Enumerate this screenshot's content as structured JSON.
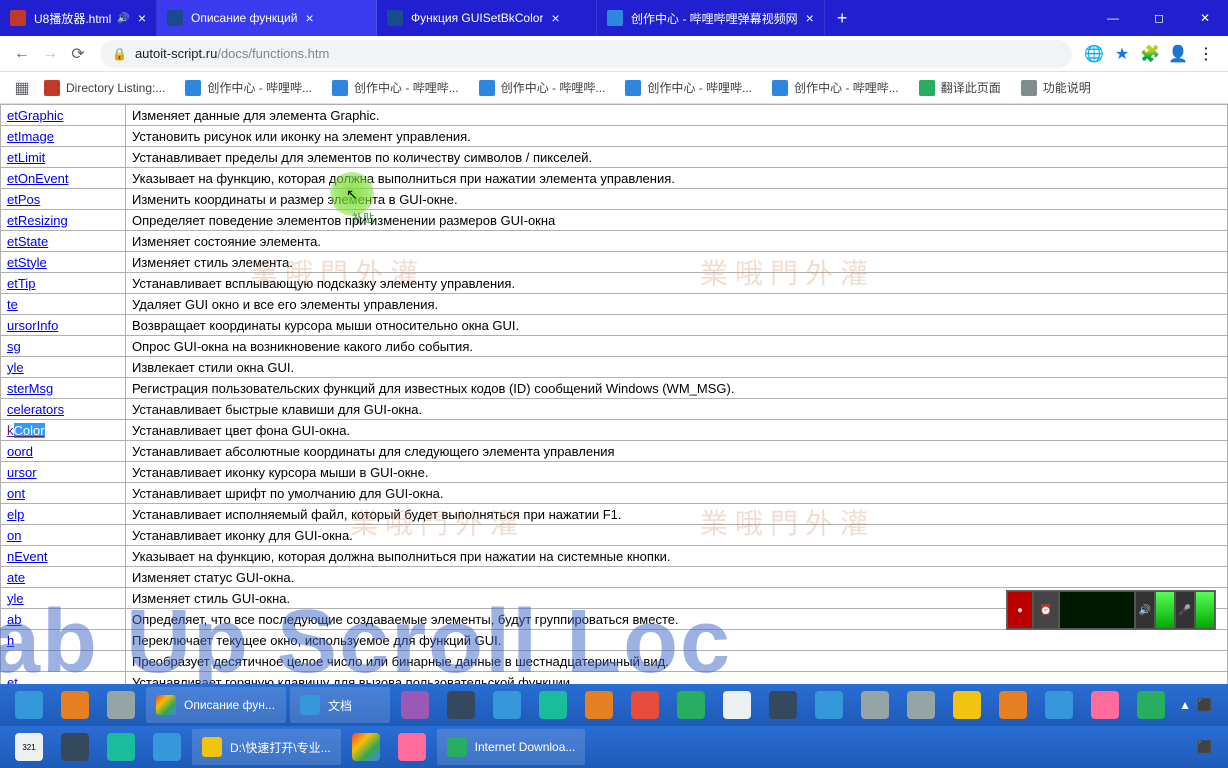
{
  "tabs": [
    {
      "title": "U8播放器.html",
      "audio": true
    },
    {
      "title": "Описание функций",
      "active": true
    },
    {
      "title": "Функция GUISetBkColor"
    },
    {
      "title": "创作中心 - 哔哩哔哩弹幕视频网"
    }
  ],
  "url": {
    "host": "autoit-script.ru",
    "path": "/docs/functions.htm"
  },
  "bookmarks": [
    {
      "label": "Directory Listing:...",
      "cls": "red"
    },
    {
      "label": "创作中心 - 哔哩哔...",
      "cls": "blue"
    },
    {
      "label": "创作中心 - 哔哩哔...",
      "cls": "blue"
    },
    {
      "label": "创作中心 - 哔哩哔...",
      "cls": "blue"
    },
    {
      "label": "创作中心 - 哔哩哔...",
      "cls": "blue"
    },
    {
      "label": "创作中心 - 哔哩哔...",
      "cls": "blue"
    },
    {
      "label": "翻译此页面",
      "cls": "green"
    },
    {
      "label": "功能说明",
      "cls": "gray"
    }
  ],
  "rows": [
    {
      "fn": "etGraphic",
      "desc": "Изменяет данные для элемента Graphic."
    },
    {
      "fn": "etImage",
      "desc": "Установить рисунок или иконку на элемент управления."
    },
    {
      "fn": "etLimit",
      "desc": "Устанавливает пределы для элементов по количеству символов / пикселей."
    },
    {
      "fn": "etOnEvent",
      "desc": "Указывает на функцию, которая должна выполниться при нажатии элемента управления."
    },
    {
      "fn": "etPos",
      "desc": "Изменить координаты и размер элемента в GUI-окне."
    },
    {
      "fn": "etResizing",
      "desc": "Определяет поведение элементов при изменении размеров GUI-окна"
    },
    {
      "fn": "etState",
      "desc": "Изменяет состояние элемента."
    },
    {
      "fn": "etStyle",
      "desc": "Изменяет стиль элемента."
    },
    {
      "fn": "etTip",
      "desc": "Устанавливает всплывающую подсказку элементу управления."
    },
    {
      "fn": "te",
      "desc": "Удаляет GUI окно и все его элементы управления."
    },
    {
      "fn": "ursorInfo",
      "desc": "Возвращает координаты курсора мыши относительно окна GUI."
    },
    {
      "fn": "sg",
      "desc": "Опрос GUI-окна на возникновение какого либо события."
    },
    {
      "fn": "yle",
      "desc": "Извлекает стили окна GUI."
    },
    {
      "fn": "sterMsg",
      "desc": "Регистрация пользовательских функций для известных кодов (ID) сообщений Windows (WM_MSG)."
    },
    {
      "fn": "celerators",
      "desc": "Устанавливает быстрые клавиши для GUI-окна."
    },
    {
      "fn": "kColor",
      "desc": "Устанавливает цвет фона GUI-окна.",
      "hl": true,
      "visited": true
    },
    {
      "fn": "oord",
      "desc": "Устанавливает абсолютные координаты для следующего элемента управления"
    },
    {
      "fn": "ursor",
      "desc": "Устанавливает иконку курсора мыши в GUI-окне."
    },
    {
      "fn": "ont",
      "desc": "Устанавливает шрифт по умолчанию для GUI-окна."
    },
    {
      "fn": "elp",
      "desc": "Устанавливает исполняемый файл, который будет выполняться при нажатии F1."
    },
    {
      "fn": "on",
      "desc": "Устанавливает иконку для GUI-окна."
    },
    {
      "fn": "nEvent",
      "desc": "Указывает на функцию, которая должна выполниться при нажатии на системные кнопки."
    },
    {
      "fn": "ate",
      "desc": "Изменяет статус GUI-окна."
    },
    {
      "fn": "yle",
      "desc": "Изменяет стиль GUI-окна."
    },
    {
      "fn": "ab",
      "desc": "Определяет, что все последующие создаваемые элементы, будут группироваться вместе."
    },
    {
      "fn": "h",
      "desc": "Переключает текущее окно, используемое для функций GUI."
    },
    {
      "fn": "",
      "desc": "Преобразует десятичное целое число или бинарные данные в шестнадцатеричный вид."
    },
    {
      "fn": "et",
      "desc": "Устанавливает горячую клавишу для вызова пользовательской функции."
    }
  ],
  "watermarks": [
    "業 哦 門 外 灌",
    "業 哦 門 外 灌",
    "業 哦 門 外 灌"
  ],
  "bigtext": "ab Up Scroll Loc",
  "cursor_label": "补贴",
  "taskbar1": {
    "active_tab": "Описание фун...",
    "doc_tab": "文档"
  },
  "taskbar2": {
    "folder_tab": "D:\\快速打开\\专业...",
    "dl_tab": "Internet Downloa..."
  }
}
